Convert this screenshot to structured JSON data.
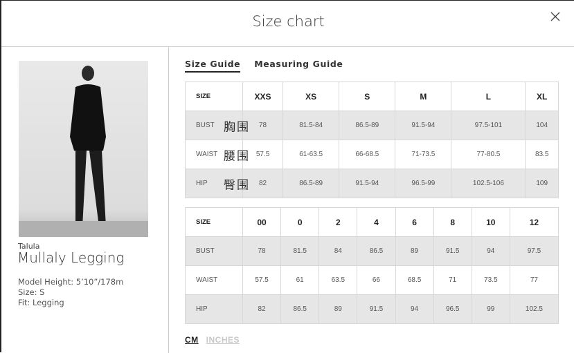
{
  "header": {
    "title": "Size chart"
  },
  "product": {
    "brand": "Talula",
    "name": "Mullaly Legging",
    "model_height": "Model Height: 5’10”/178m",
    "size": "Size: S",
    "fit": "Fit: Legging"
  },
  "tabs": [
    {
      "label": "Size Guide",
      "active": true
    },
    {
      "label": "Measuring Guide",
      "active": false
    }
  ],
  "table_alpha": {
    "headers": [
      "SIZE",
      "XXS",
      "XS",
      "S",
      "M",
      "L",
      "XL"
    ],
    "rows": [
      {
        "label": "BUST",
        "note": "胸围",
        "values": [
          "78",
          "81.5-84",
          "86.5-89",
          "91.5-94",
          "97.5-101",
          "104"
        ]
      },
      {
        "label": "WAIST",
        "note": "腰围",
        "values": [
          "57.5",
          "61-63.5",
          "66-68.5",
          "71-73.5",
          "77-80.5",
          "83.5"
        ]
      },
      {
        "label": "HIP",
        "note": "臀围",
        "values": [
          "82",
          "86.5-89",
          "91.5-94",
          "96.5-99",
          "102.5-106",
          "109"
        ]
      }
    ]
  },
  "table_numeric": {
    "headers": [
      "SIZE",
      "00",
      "0",
      "2",
      "4",
      "6",
      "8",
      "10",
      "12"
    ],
    "rows": [
      {
        "label": "BUST",
        "values": [
          "78",
          "81.5",
          "84",
          "86.5",
          "89",
          "91.5",
          "94",
          "97.5"
        ]
      },
      {
        "label": "WAIST",
        "values": [
          "57.5",
          "61",
          "63.5",
          "66",
          "68.5",
          "71",
          "73.5",
          "77"
        ]
      },
      {
        "label": "HIP",
        "values": [
          "82",
          "86.5",
          "89",
          "91.5",
          "94",
          "96.5",
          "99",
          "102.5"
        ]
      }
    ]
  },
  "units": {
    "cm": "CM",
    "inches": "INCHES",
    "selected": "CM"
  }
}
